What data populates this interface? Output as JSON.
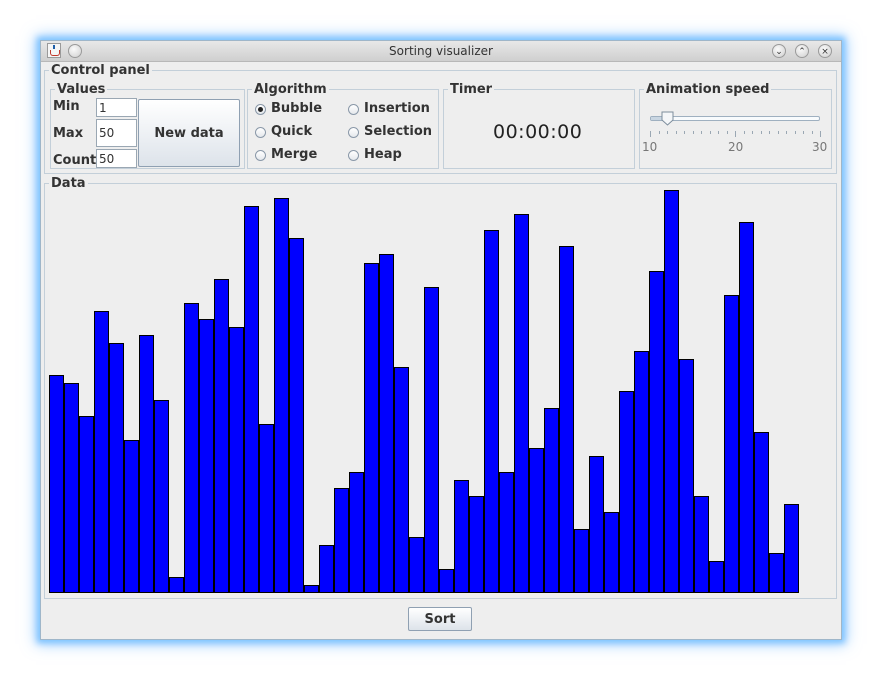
{
  "window": {
    "title": "Sorting visualizer",
    "buttons": {
      "minimize": "⌄",
      "maximize": "⌃",
      "close": "×"
    }
  },
  "control_panel": {
    "title": "Control panel",
    "values": {
      "title": "Values",
      "min_label": "Min",
      "min_value": "1",
      "max_label": "Max",
      "max_value": "50",
      "count_label": "Count",
      "count_value": "50",
      "new_data_label": "New data"
    },
    "algorithm": {
      "title": "Algorithm",
      "options": [
        {
          "label": "Bubble",
          "selected": true
        },
        {
          "label": "Insertion",
          "selected": false
        },
        {
          "label": "Quick",
          "selected": false
        },
        {
          "label": "Selection",
          "selected": false
        },
        {
          "label": "Merge",
          "selected": false
        },
        {
          "label": "Heap",
          "selected": false
        }
      ]
    },
    "timer": {
      "title": "Timer",
      "value": "00:00:00"
    },
    "animation_speed": {
      "title": "Animation speed",
      "min": 10,
      "max": 30,
      "value": 12,
      "labels": [
        "10",
        "20",
        "30"
      ]
    }
  },
  "data_panel": {
    "title": "Data",
    "max_value": 50,
    "values": [
      27,
      26,
      22,
      35,
      31,
      19,
      32,
      24,
      2,
      36,
      34,
      39,
      33,
      48,
      21,
      49,
      44,
      1,
      6,
      13,
      15,
      41,
      42,
      28,
      7,
      38,
      3,
      14,
      12,
      45,
      15,
      47,
      18,
      23,
      43,
      8,
      17,
      10,
      25,
      30,
      40,
      50,
      29,
      12,
      4,
      37,
      46,
      20,
      5,
      11
    ],
    "bar_color": "#0000ff"
  },
  "footer": {
    "sort_label": "Sort"
  }
}
